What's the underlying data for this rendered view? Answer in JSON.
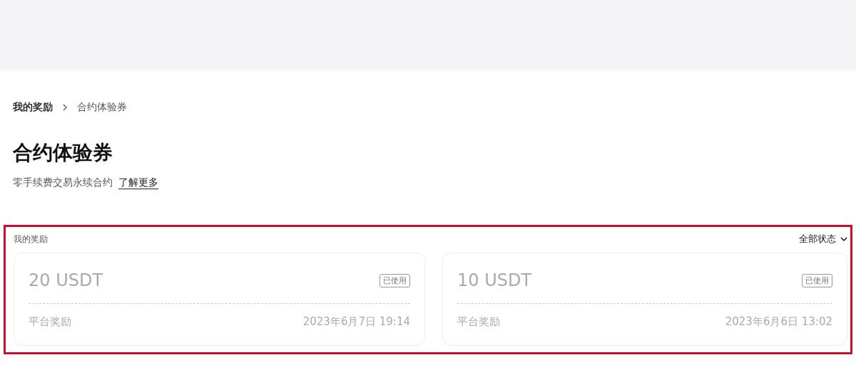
{
  "breadcrumb": [
    {
      "label": "我的奖励"
    },
    {
      "label": "合约体验券"
    }
  ],
  "title": "合约体验券",
  "subtitle": {
    "text": "零手续费交易永续合约",
    "link": "了解更多"
  },
  "rewards": {
    "label": "我的奖励",
    "highlighted": true,
    "filter": "全部状态",
    "cards": [
      {
        "amount": "20 USDT",
        "status": "已使用",
        "used": true,
        "source": "平台奖励",
        "time": "2023年6月7日 19:14"
      },
      {
        "amount": "10 USDT",
        "status": "已使用",
        "used": true,
        "source": "平台奖励",
        "time": "2023年6月6日 13:02"
      }
    ]
  }
}
